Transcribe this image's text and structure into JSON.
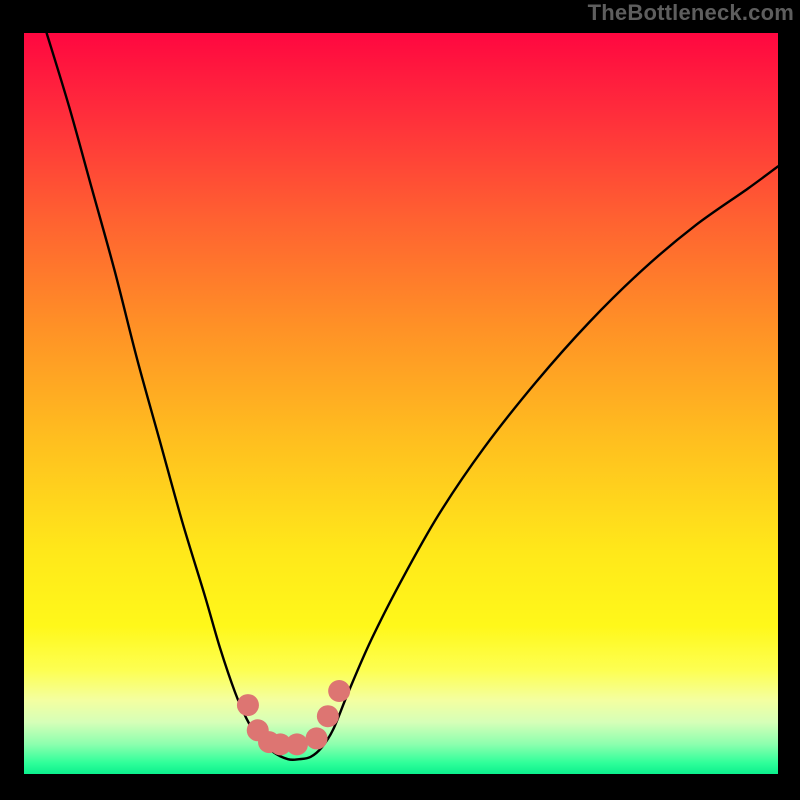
{
  "credit": "TheBottleneck.com",
  "colors": {
    "frame": "#000000",
    "curve": "#000000",
    "marker": "#dd7572",
    "gradient_stops": [
      {
        "offset": 0.0,
        "color": "#ff0740"
      },
      {
        "offset": 0.1,
        "color": "#ff2a3c"
      },
      {
        "offset": 0.25,
        "color": "#ff6131"
      },
      {
        "offset": 0.4,
        "color": "#ff9226"
      },
      {
        "offset": 0.55,
        "color": "#ffbf1f"
      },
      {
        "offset": 0.7,
        "color": "#ffe81a"
      },
      {
        "offset": 0.8,
        "color": "#fff81a"
      },
      {
        "offset": 0.86,
        "color": "#fdff52"
      },
      {
        "offset": 0.9,
        "color": "#f4ffa0"
      },
      {
        "offset": 0.93,
        "color": "#d6ffb8"
      },
      {
        "offset": 0.96,
        "color": "#8cffae"
      },
      {
        "offset": 0.985,
        "color": "#2fff9a"
      },
      {
        "offset": 1.0,
        "color": "#0bf08d"
      }
    ]
  },
  "chart_data": {
    "type": "line",
    "title": "",
    "xlabel": "",
    "ylabel": "",
    "xlim": [
      0,
      100
    ],
    "ylim": [
      0,
      100
    ],
    "x": [
      3,
      6,
      9,
      12,
      15,
      18,
      21,
      24,
      26,
      28,
      29.5,
      31,
      33,
      35,
      36.5,
      38,
      39.5,
      41,
      43,
      46,
      50,
      55,
      61,
      68,
      75,
      82,
      89,
      96,
      100
    ],
    "values": [
      100,
      90,
      79,
      68,
      56,
      45,
      34,
      24,
      17,
      11,
      7.5,
      5,
      3,
      2,
      2,
      2.3,
      3.6,
      6,
      11,
      18,
      26,
      35,
      44,
      53,
      61,
      68,
      74,
      79,
      82
    ],
    "markers": {
      "x": [
        29.7,
        31.0,
        32.5,
        34.0,
        36.2,
        38.8,
        40.3,
        41.8
      ],
      "y": [
        9.3,
        5.9,
        4.3,
        4.0,
        4.0,
        4.8,
        7.8,
        11.2
      ]
    },
    "note": "x and y are in percent of the plot area width/height; y is height above the bottom edge. Values are visual estimates from the raster."
  }
}
